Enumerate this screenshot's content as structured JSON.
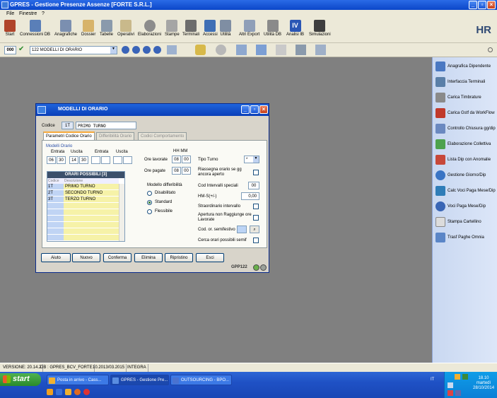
{
  "window": {
    "title": "GPRES - Gestione Presenze Assenze  [FORTE S.R.L.]"
  },
  "menu": [
    "File",
    "Finestre",
    "?"
  ],
  "toolbar": [
    {
      "label": "Start",
      "icon": "house-icon"
    },
    {
      "label": "Connessioni DB",
      "icon": "network-icon"
    },
    {
      "label": "Anagrafiche",
      "icon": "people-icon"
    },
    {
      "label": "Dossier",
      "icon": "folder-icon"
    },
    {
      "label": "Tabelle",
      "icon": "table-icon"
    },
    {
      "label": "Operativi",
      "icon": "clipboard-icon"
    },
    {
      "label": "Elaborazioni",
      "icon": "gear-icon"
    },
    {
      "label": "Stampe",
      "icon": "printer-icon"
    },
    {
      "label": "Terminali",
      "icon": "terminal-icon"
    },
    {
      "label": "Accessi",
      "icon": "access-icon"
    },
    {
      "label": "Utilità",
      "icon": "tools-icon"
    },
    {
      "label": "Altri Export",
      "icon": "export-icon"
    },
    {
      "label": "Utilità DB",
      "icon": "database-icon"
    },
    {
      "label": "Analisi IB",
      "icon": "analysis-icon"
    },
    {
      "label": "Simulazioni",
      "icon": "monitor-icon"
    }
  ],
  "logo": "HR",
  "toolbar2": {
    "code": "000",
    "combo": "122 MODELLI DI ORARIO"
  },
  "right_panel": [
    "Anagrafica Dipendente",
    "Interfaccia Terminali",
    "Carica Timbrature",
    "Carica Gstf da WorkFlow",
    "Controllo Chiusura gg/dip",
    "Elaborazione Collettiva",
    "Lista Dip con Anomalie",
    "Gestione Giorno/Dip",
    "Calc Voci Paga Mese/Dip",
    "Voci Paga Mese/Dip",
    "Stampa Cartellino",
    "Trasf Paghe Omnia"
  ],
  "status": [
    "VERSIONE: 20.14.2",
    "DB : GPRES_BCV_FORTE",
    "10.2013/03.2015",
    "INTEGRA"
  ],
  "taskbar": {
    "start": "start",
    "tasks": [
      "Posta in arrivo - Cass...",
      "GPRES - Gestione Pre...",
      "OUTSOURCING - BPO..."
    ],
    "lang": "IT",
    "time": "18.10",
    "day": "martedì",
    "date": "28/10/2014"
  },
  "dialog": {
    "title": "MODELLI DI ORARIO",
    "codice_label": "Codice",
    "codice": "1T",
    "descrizione": "PRIMO TURNO",
    "tabs": [
      "Parametri Codice Orario",
      "Differibilità Orario",
      "Codici Comportamento"
    ],
    "modelli_label": "Modelli Orario",
    "entrata_label": "Entrata",
    "uscita_label": "Uscita",
    "entrata1": [
      "06",
      "30"
    ],
    "uscita1": [
      "14",
      "30"
    ],
    "grid_title": "ORARI POSSIBILI [3]",
    "grid_cols": [
      "Codice",
      "Descrizione"
    ],
    "grid_rows": [
      {
        "code": "1T",
        "desc": "PRIMO TURNO"
      },
      {
        "code": "2T",
        "desc": "SECONDO TURNO"
      },
      {
        "code": "3T",
        "desc": "TERZO TURNO"
      }
    ],
    "hhmm": "HH MM",
    "ore_lavorate_label": "Ore lavorate",
    "ore_lavorate": [
      "08",
      "00"
    ],
    "ore_pagate_label": "Ore pagate",
    "ore_pagate": [
      "08",
      "00"
    ],
    "modello_diff_label": "Modello differibilità",
    "radio": [
      "Disabilitato",
      "Standard",
      "Flessibile"
    ],
    "tipo_turno_label": "Tipo Turno",
    "tipo_turno": "*",
    "riassegna_label": "Riassegna orario se gg ancora aperto",
    "cod_intervalli_label": "Cod Intervalli speciali",
    "cod_intervalli": "00",
    "hms_label": "HM-S(+/-)",
    "hms": "0,00",
    "straordinario_label": "Straordinario intervallo",
    "apertura_label": "Apertura non Raggiunge ore Lavorate",
    "semifestivo_label": "Cod. or. semifestivo",
    "cerca_label": "Cerca orari possibili semif",
    "buttons": [
      "Aiuto",
      "Nuovo",
      "Conferma",
      "Elimina",
      "Ripristino",
      "Esci"
    ],
    "footer_code": "GPP122"
  }
}
